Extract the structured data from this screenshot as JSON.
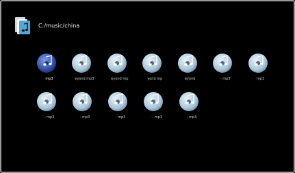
{
  "header": {
    "path": "C:/music/china",
    "folder_icon": "folder-music-icon"
  },
  "files": [
    {
      "label": "mp3",
      "icon": "music-disc-icon",
      "selected": true
    },
    {
      "label": "eyond   mp3",
      "icon": "music-disc-icon",
      "selected": false
    },
    {
      "label": "eyond   mp",
      "icon": "music-disc-icon",
      "selected": false
    },
    {
      "label": "yond   mp",
      "icon": "music-disc-icon",
      "selected": false
    },
    {
      "label": "eyond",
      "icon": "music-disc-icon",
      "selected": false
    },
    {
      "label": "-   mp3",
      "icon": "music-disc-icon",
      "selected": false
    },
    {
      "label": "mp3",
      "icon": "music-disc-icon",
      "selected": false
    },
    {
      "label": "-   mp3",
      "icon": "music-disc-icon",
      "selected": false
    },
    {
      "label": "-   mp3",
      "icon": "music-disc-icon",
      "selected": false
    },
    {
      "label": "-   mp3",
      "icon": "music-disc-icon",
      "selected": false
    },
    {
      "label": "-  -   mp3",
      "icon": "music-disc-icon",
      "selected": false
    },
    {
      "label": "-   mp3",
      "icon": "music-disc-icon",
      "selected": false
    }
  ],
  "colors": {
    "background": "#000000",
    "selected_disc": "#2f4fa8",
    "disc": "#a9c6d8",
    "note": "#ffffff"
  }
}
